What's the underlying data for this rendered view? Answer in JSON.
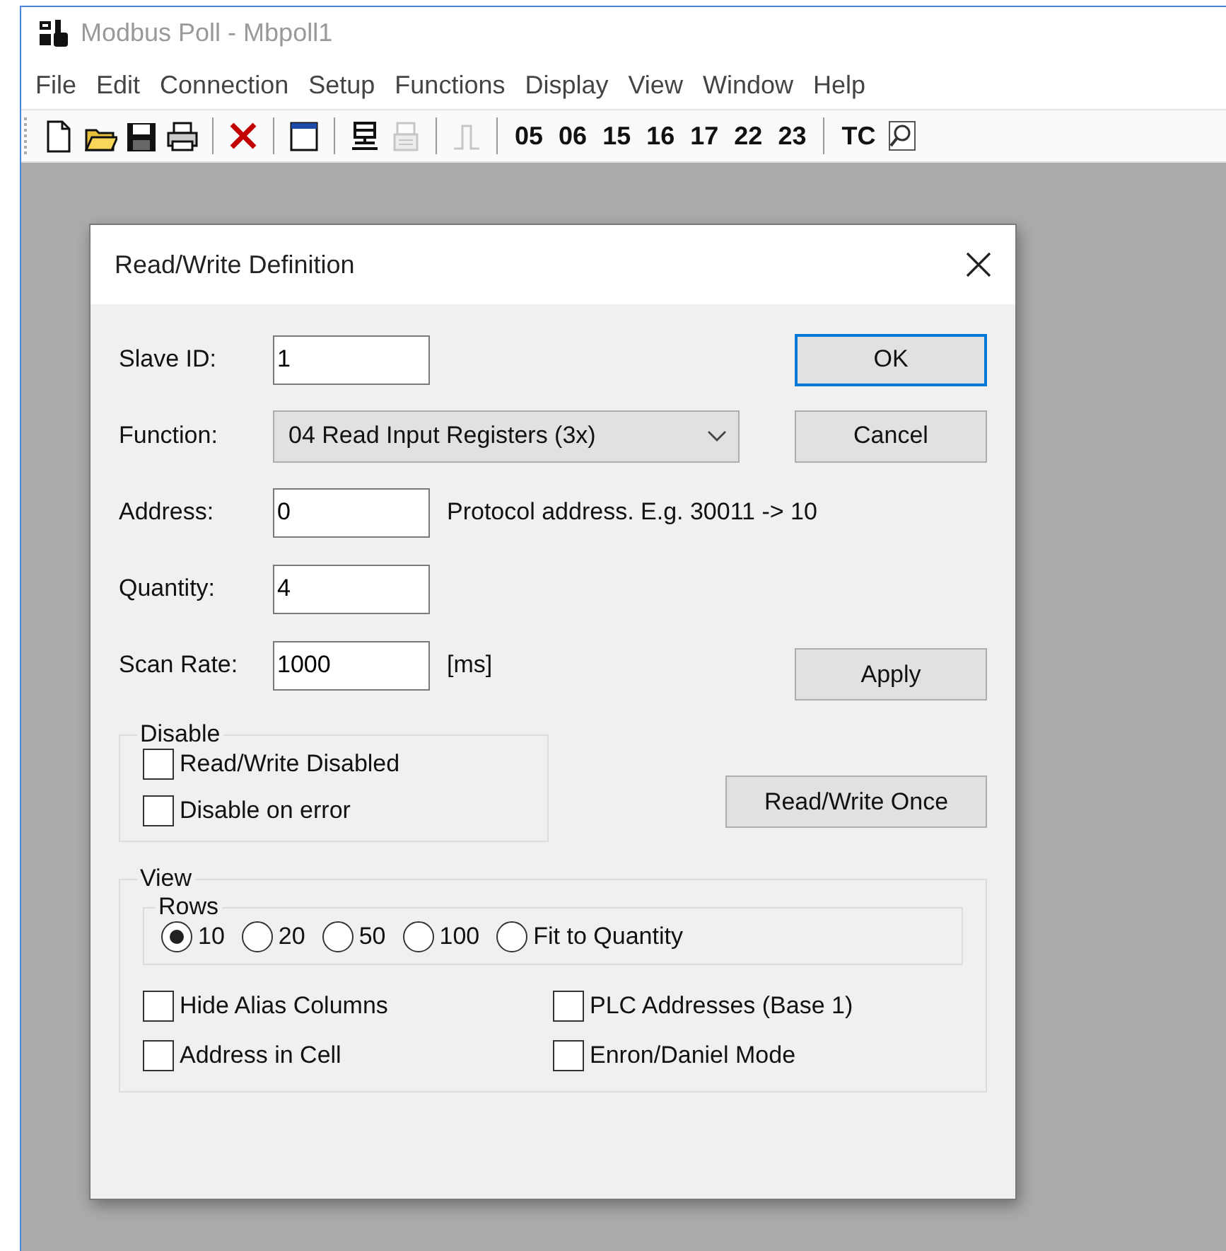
{
  "window": {
    "title": "Modbus Poll - Mbpoll1"
  },
  "menu": [
    "File",
    "Edit",
    "Connection",
    "Setup",
    "Functions",
    "Display",
    "View",
    "Window",
    "Help"
  ],
  "toolbar": [
    {
      "kind": "icon",
      "disabled": false
    },
    {
      "kind": "icon",
      "disabled": false
    },
    {
      "kind": "icon",
      "disabled": false
    },
    {
      "kind": "icon",
      "disabled": false
    },
    {
      "kind": "separator"
    },
    {
      "kind": "icon",
      "disabled": false
    },
    {
      "kind": "separator"
    },
    {
      "kind": "icon",
      "disabled": false
    },
    {
      "kind": "separator"
    },
    {
      "kind": "icon",
      "disabled": false
    },
    {
      "kind": "icon",
      "disabled": true
    },
    {
      "kind": "separator"
    },
    {
      "kind": "icon",
      "disabled": true
    },
    {
      "kind": "separator"
    },
    {
      "kind": "code",
      "label": "05"
    },
    {
      "kind": "code",
      "label": "06"
    },
    {
      "kind": "code",
      "label": "15"
    },
    {
      "kind": "code",
      "label": "16"
    },
    {
      "kind": "code",
      "label": "17"
    },
    {
      "kind": "code",
      "label": "22"
    },
    {
      "kind": "code",
      "label": "23"
    },
    {
      "kind": "separator"
    },
    {
      "kind": "code",
      "label": "TC"
    },
    {
      "kind": "icon",
      "disabled": false
    }
  ],
  "dialog": {
    "title": "Read/Write Definition",
    "slave_id": {
      "label": "Slave ID:",
      "value": "1"
    },
    "function": {
      "label": "Function:",
      "value": "04 Read Input Registers (3x)"
    },
    "address": {
      "label": "Address:",
      "value": "0",
      "hint": "Protocol address. E.g. 30011 -> 10"
    },
    "quantity": {
      "label": "Quantity:",
      "value": "4"
    },
    "scan_rate": {
      "label": "Scan Rate:",
      "value": "1000",
      "unit": "[ms]"
    },
    "buttons": {
      "ok": {
        "label": "OK",
        "default": true
      },
      "cancel": {
        "label": "Cancel",
        "default": false
      },
      "apply": {
        "label": "Apply",
        "default": false
      },
      "once": {
        "label": "Read/Write Once",
        "default": false
      }
    },
    "disable": {
      "title": "Disable",
      "options": [
        {
          "label": "Read/Write Disabled",
          "checked": false
        },
        {
          "label": "Disable on error",
          "checked": false
        }
      ]
    },
    "view": {
      "title": "View",
      "rows": {
        "title": "Rows",
        "options": [
          {
            "label": "10",
            "selected": true
          },
          {
            "label": "20",
            "selected": false
          },
          {
            "label": "50",
            "selected": false
          },
          {
            "label": "100",
            "selected": false
          },
          {
            "label": "Fit to Quantity",
            "selected": false
          }
        ]
      },
      "options": [
        {
          "label": "Hide Alias Columns",
          "checked": false
        },
        {
          "label": "PLC Addresses (Base 1)",
          "checked": false
        },
        {
          "label": "Address in Cell",
          "checked": false
        },
        {
          "label": "Enron/Daniel Mode",
          "checked": false
        }
      ]
    }
  }
}
